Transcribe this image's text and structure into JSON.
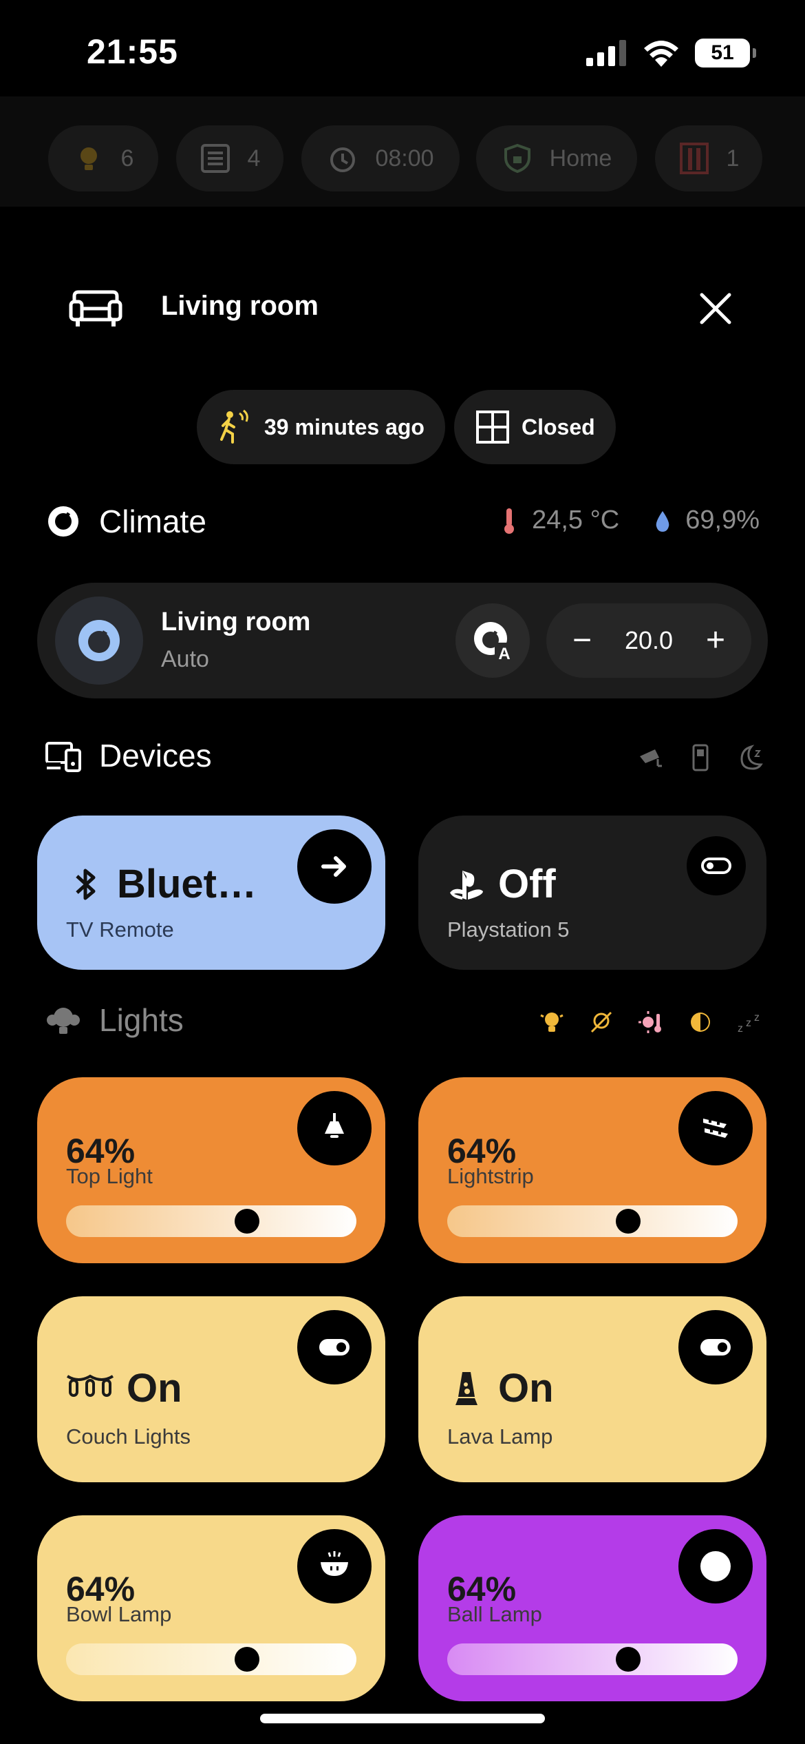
{
  "status": {
    "time": "21:55",
    "battery": "51"
  },
  "top_chips": [
    {
      "icon": "light-bulb-icon",
      "value": "6"
    },
    {
      "icon": "list-icon",
      "value": "4"
    },
    {
      "icon": "alarm-icon",
      "value": "08:00"
    },
    {
      "icon": "shield-home-icon",
      "value": "Home"
    },
    {
      "icon": "door-icon",
      "value": "1"
    }
  ],
  "room": {
    "title": "Living room"
  },
  "pills": {
    "motion": "39 minutes ago",
    "window": "Closed"
  },
  "climate": {
    "title": "Climate",
    "temperature": "24,5 °C",
    "humidity": "69,9%",
    "card": {
      "name": "Living room",
      "mode": "Auto",
      "setpoint": "20.0"
    }
  },
  "devices": {
    "title": "Devices",
    "tiles": [
      {
        "value": "Bluet…",
        "label": "TV Remote",
        "icon": "bluetooth-icon",
        "action_icon": "arrow-right-icon"
      },
      {
        "value": "Off",
        "label": "Playstation 5",
        "icon": "playstation-icon",
        "action_icon": "toggle-off-icon"
      }
    ]
  },
  "lights": {
    "title": "Lights",
    "tiles": [
      {
        "value": "64%",
        "label": "Top Light",
        "brightness": 0.64,
        "icon": "ceiling-light-icon"
      },
      {
        "value": "64%",
        "label": "Lightstrip",
        "brightness": 0.64,
        "icon": "led-strip-icon"
      },
      {
        "value": "On",
        "label": "Couch Lights",
        "icon": "string-lights-icon"
      },
      {
        "value": "On",
        "label": "Lava Lamp",
        "icon": "lava-lamp-icon"
      },
      {
        "value": "64%",
        "label": "Bowl Lamp",
        "brightness": 0.64,
        "icon": "bowl-lamp-icon"
      },
      {
        "value": "64%",
        "label": "Ball Lamp",
        "brightness": 0.64,
        "icon": "ball-lamp-icon"
      }
    ]
  },
  "colors": {
    "orange": "#ee8c35",
    "yellow": "#f7d98a",
    "purple": "#b43ce8",
    "blue": "#a7c4f5"
  }
}
